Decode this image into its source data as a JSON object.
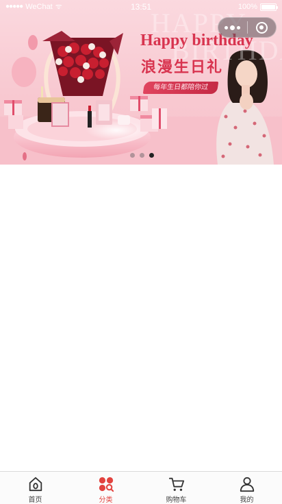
{
  "status_bar": {
    "signal": "●●●●●",
    "carrier": "WeChat",
    "wifi": "ᯤ",
    "time": "13:51",
    "battery_text": "100%",
    "battery_level": 1.0
  },
  "capsule": {
    "more_icon": "more-dots-icon",
    "close_icon": "close-target-icon"
  },
  "banner": {
    "ghost_line_1": "HAPPY",
    "ghost_line_2": "BIRTHDAY",
    "headline": "Happy birthday",
    "subheadline": "浪漫生日礼",
    "slogan": "每年生日都陪你过",
    "slides_total": 3,
    "active_slide_index": 2,
    "accent_color": "#d8344f"
  },
  "tabbar": {
    "active_color": "#e2433f",
    "items": [
      {
        "label": "首页",
        "icon": "home-icon",
        "active": false
      },
      {
        "label": "分类",
        "icon": "category-icon",
        "active": true
      },
      {
        "label": "购物车",
        "icon": "cart-icon",
        "active": false
      },
      {
        "label": "我的",
        "icon": "user-icon",
        "active": false
      }
    ]
  }
}
